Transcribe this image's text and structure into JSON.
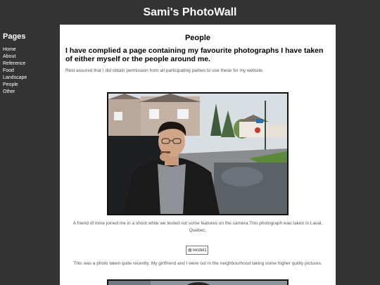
{
  "site": {
    "title": "Sami's PhotoWall"
  },
  "sidebar": {
    "heading": "Pages",
    "items": [
      {
        "label": "Home"
      },
      {
        "label": "About"
      },
      {
        "label": "Reference"
      },
      {
        "label": "Food"
      },
      {
        "label": "Landscape"
      },
      {
        "label": "People"
      },
      {
        "label": "Other"
      }
    ]
  },
  "main": {
    "page_title": "People",
    "intro_heading": "I have complied a page containing my favourite photographs I have taken of either myself or the people around me.",
    "intro_text": "Rest assured that I did obtain permission from all participating parties to use these for my website.",
    "photos": [
      {
        "caption": "A friend of mine joined me in a shoot while we tested out some features on the camera.This photograph was taken in Laval, Quebec."
      },
      {
        "alt": "rendel1",
        "caption": "This was a photo taken quite recently. My girlfriend and I were out in the neighbourhood taking some higher quility pictures."
      }
    ]
  },
  "colors": {
    "page_background": "#333333",
    "content_background": "#ffffff",
    "text_muted": "#555555"
  }
}
